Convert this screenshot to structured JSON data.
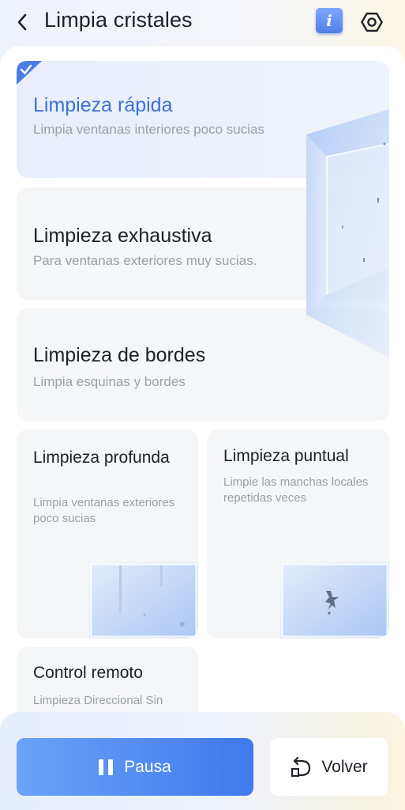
{
  "header": {
    "title": "Limpia cristales",
    "back_icon": "chevron-left-icon",
    "info_icon": "info-icon",
    "info_glyph": "i",
    "settings_icon": "hexagon-gear-icon"
  },
  "modes": [
    {
      "title": "Limpieza rápida",
      "description": "Limpia ventanas interiores poco sucias",
      "selected": true
    },
    {
      "title": "Limpieza exhaustiva",
      "description": "Para ventanas exteriores muy sucias.",
      "selected": false
    },
    {
      "title": "Limpieza de bordes",
      "description": "Limpia esquinas y bordes",
      "selected": false
    },
    {
      "title": "Limpieza profunda",
      "description": "Limpia ventanas exteriores poco sucias",
      "selected": false
    },
    {
      "title": "Limpieza puntual",
      "description": "Limpie las manchas locales repetidas veces",
      "selected": false
    },
    {
      "title": "Control remoto",
      "description": "Limpieza Direccional Sin",
      "selected": false
    }
  ],
  "actions": {
    "pause_label": "Pausa",
    "return_label": "Volver"
  },
  "colors": {
    "accent": "#3e6fd8",
    "button_start": "#6aa3f7",
    "button_end": "#3f79ec"
  }
}
